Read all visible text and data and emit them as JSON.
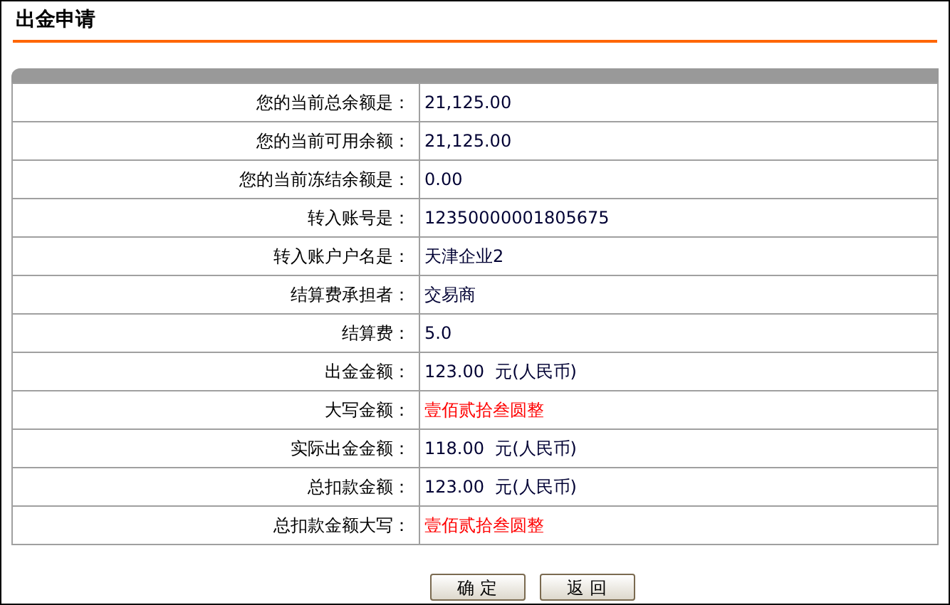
{
  "title": "出金申请",
  "rows": [
    {
      "label": "您的当前总余额是：",
      "value": "21,125.00",
      "kind": "plain"
    },
    {
      "label": "您的当前可用余额：",
      "value": "21,125.00",
      "kind": "plain"
    },
    {
      "label": "您的当前冻结余额是：",
      "value": "0.00",
      "kind": "plain"
    },
    {
      "label": "转入账号是：",
      "value": "12350000001805675",
      "kind": "plain"
    },
    {
      "label": "转入账户户名是：",
      "value": "天津企业2",
      "kind": "plain"
    },
    {
      "label": "结算费承担者：",
      "value": "交易商",
      "kind": "plain"
    },
    {
      "label": "结算费：",
      "value": "5.0",
      "kind": "plain"
    },
    {
      "label": "出金金额：",
      "value": "123.00",
      "unit": "元(人民币)",
      "kind": "plain"
    },
    {
      "label": "大写金额：",
      "value": "壹佰贰拾叁圆整",
      "kind": "words"
    },
    {
      "label": "实际出金金额：",
      "value": "118.00",
      "unit": "元(人民币)",
      "kind": "plain"
    },
    {
      "label": "总扣款金额：",
      "value": "123.00",
      "unit": "元(人民币)",
      "kind": "plain"
    },
    {
      "label": "总扣款金额大写：",
      "value": "壹佰贰拾叁圆整",
      "kind": "words"
    }
  ],
  "buttons": [
    "确 定",
    "返 回"
  ]
}
